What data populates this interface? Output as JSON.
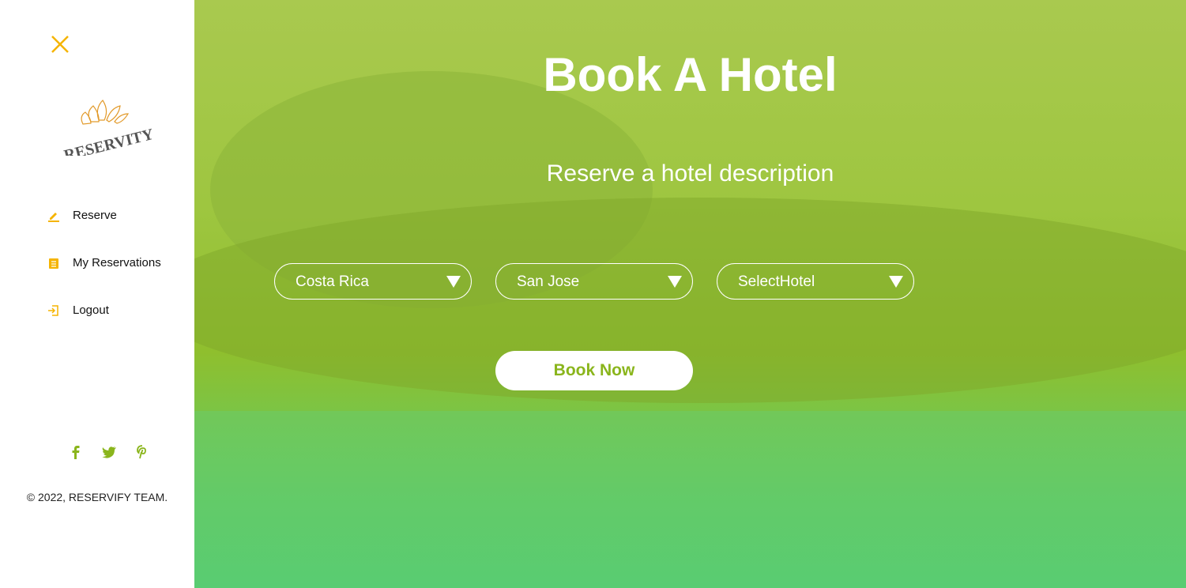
{
  "sidebar": {
    "logo_text": "RESERVITY",
    "nav": [
      {
        "label": "Reserve",
        "icon": "pencil-icon"
      },
      {
        "label": "My Reservations",
        "icon": "list-icon"
      },
      {
        "label": "Logout",
        "icon": "logout-icon"
      }
    ],
    "social": [
      "facebook-icon",
      "twitter-icon",
      "pinterest-icon"
    ],
    "copyright": "© 2022, RESERVIFY TEAM."
  },
  "hero": {
    "title": "Book A Hotel",
    "subtitle": "Reserve a hotel description",
    "country": "Costa Rica",
    "city": "San Jose",
    "hotel": "SelectHotel",
    "book_label": "Book Now"
  },
  "colors": {
    "accent": "#f5b400",
    "green": "#8ab51c"
  }
}
